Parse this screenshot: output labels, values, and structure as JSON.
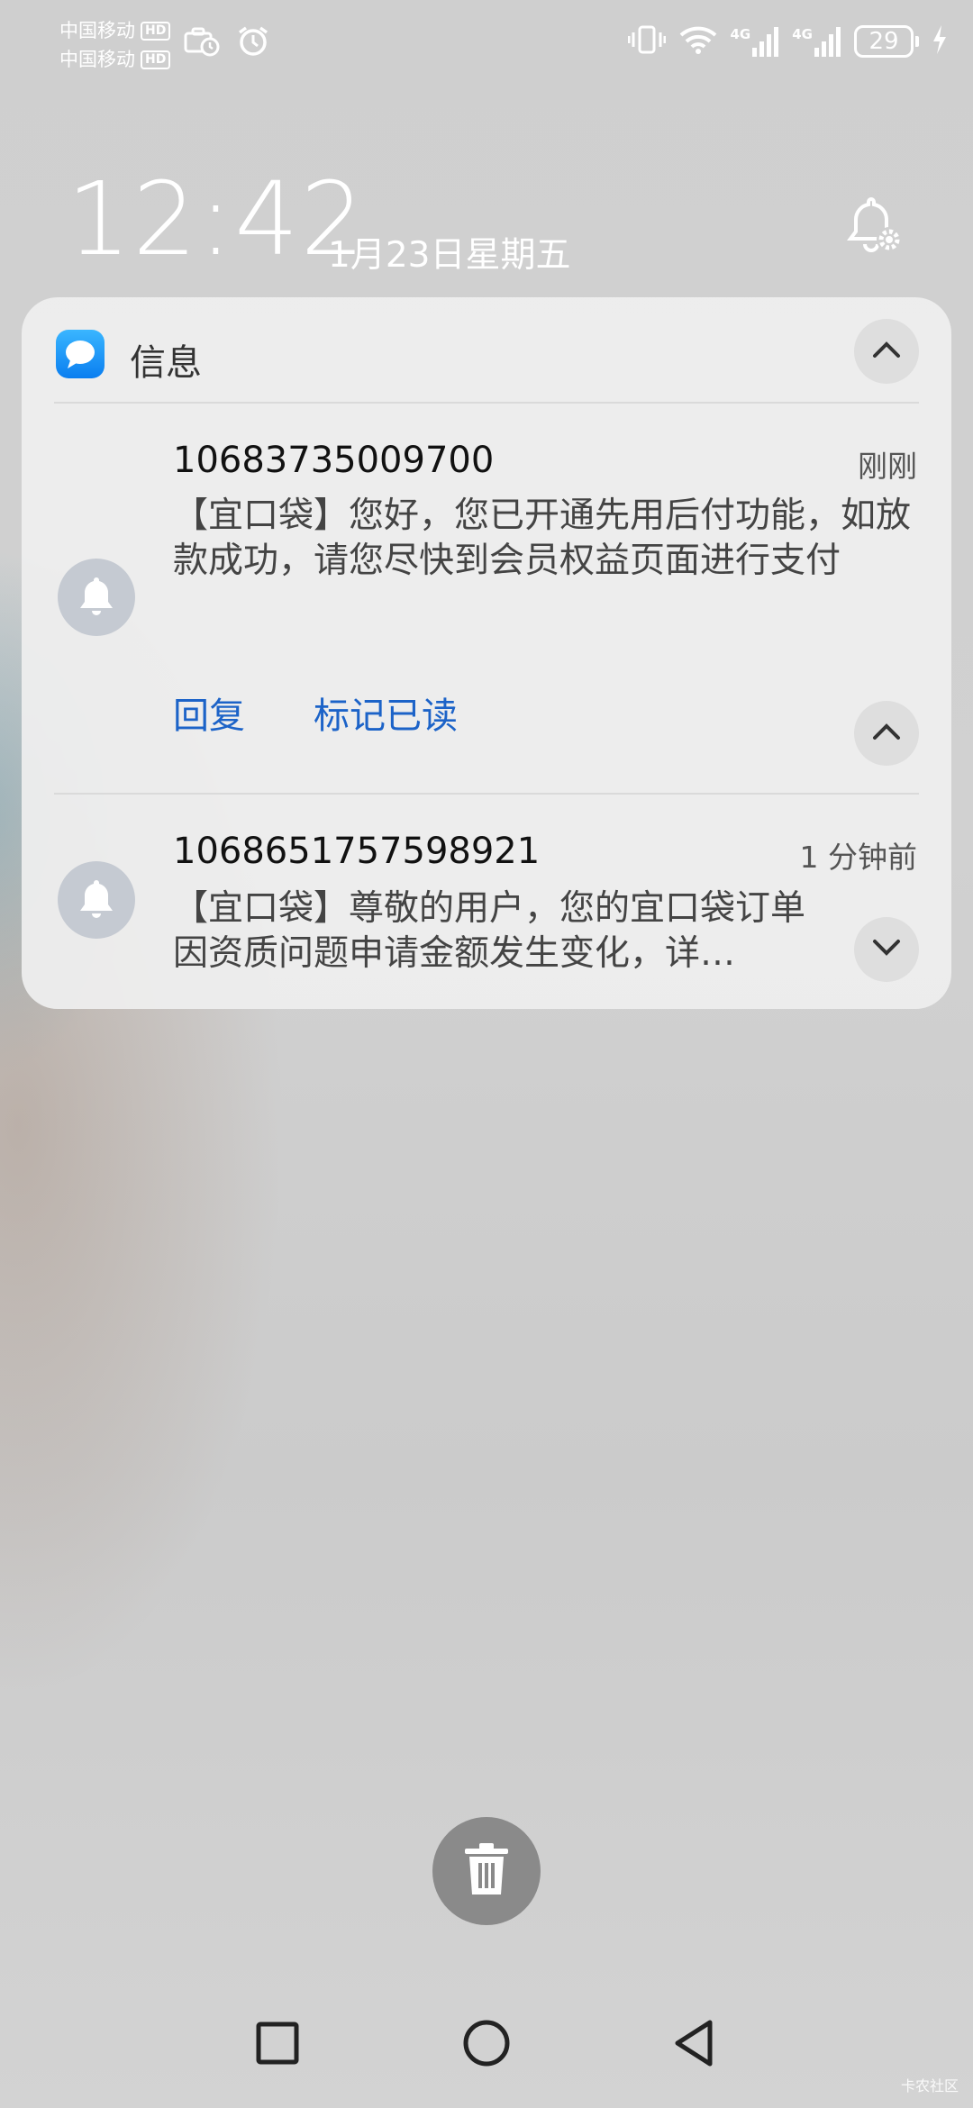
{
  "status_bar": {
    "carrier1": "中国移动",
    "carrier2": "中国移动",
    "hd_badge": "HD",
    "network1": "4G",
    "network2": "4G",
    "battery_level": "29",
    "icons": [
      "briefcase-clock-icon",
      "alarm-icon",
      "vibrate-icon",
      "wifi-icon",
      "signal-icon",
      "charging-icon"
    ]
  },
  "lock": {
    "time": "12:42",
    "date": "1月23日星期五"
  },
  "notification_group": {
    "app_name": "信息",
    "app_icon": "message-bubble-icon",
    "accent_color": "#1c63c8",
    "messages": [
      {
        "sender": "10683735009700",
        "time": "刚刚",
        "body": "【宜口袋】您好，您已开通先用后付功能，如放款成功，请您尽快到会员权益页面进行支付",
        "actions": [
          "回复",
          "标记已读"
        ]
      },
      {
        "sender": "1068651757598921",
        "time": "1 分钟前",
        "body": "【宜口袋】尊敬的用户，您的宜口袋订单因资质问题申请金额发生变化，详…"
      }
    ]
  },
  "watermark": "卡农社区"
}
